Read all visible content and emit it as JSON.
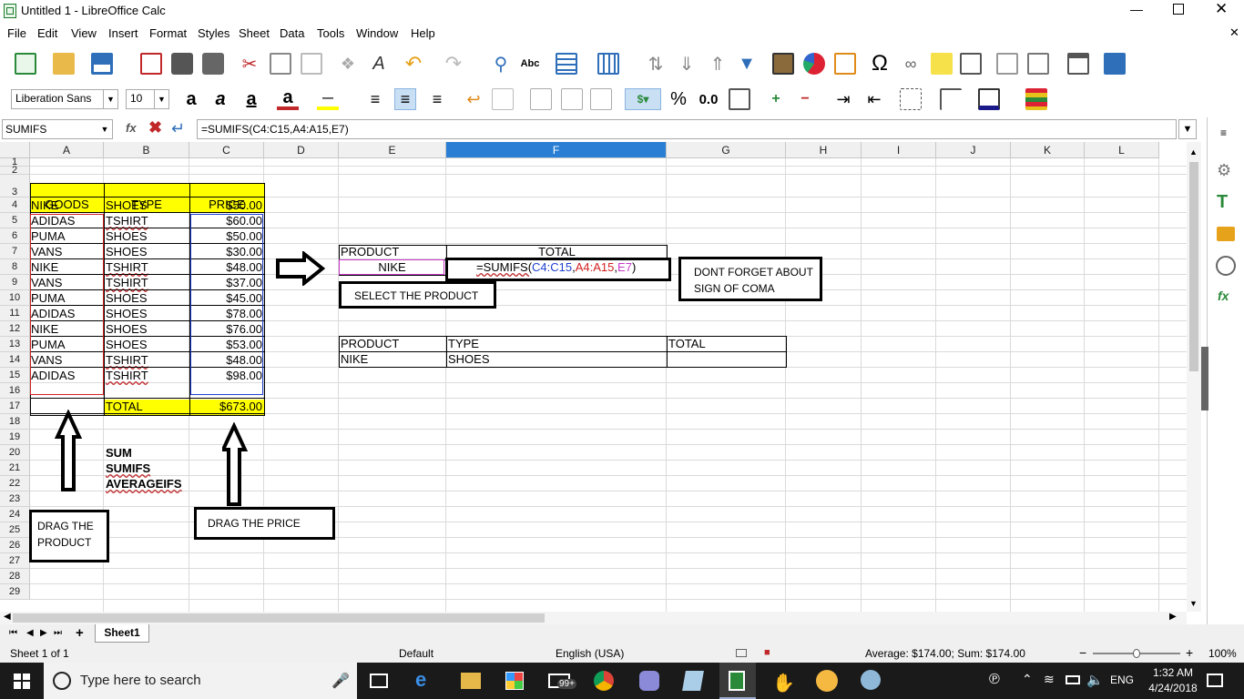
{
  "window": {
    "title": "Untitled 1 - LibreOffice Calc"
  },
  "menu": [
    "File",
    "Edit",
    "View",
    "Insert",
    "Format",
    "Styles",
    "Sheet",
    "Data",
    "Tools",
    "Window",
    "Help"
  ],
  "font": {
    "name": "Liberation Sans",
    "size": "10"
  },
  "namebox": "SUMIFS",
  "formula": "=SUMIFS(C4:C15,A4:A15,E7)",
  "columns": [
    "A",
    "B",
    "C",
    "D",
    "E",
    "F",
    "G",
    "H",
    "I",
    "J",
    "K",
    "L"
  ],
  "rows": [
    "1",
    "2",
    "3",
    "4",
    "5",
    "6",
    "7",
    "8",
    "9",
    "10",
    "11",
    "12",
    "13",
    "14",
    "15",
    "16",
    "17",
    "18",
    "19",
    "20",
    "21",
    "22",
    "23",
    "24",
    "25",
    "26",
    "27",
    "28",
    "29"
  ],
  "table": {
    "headers": [
      "GOODS",
      "TYPE",
      "PRICE"
    ],
    "rows": [
      [
        "NIKE",
        "SHOES",
        "$50.00"
      ],
      [
        "ADIDAS",
        "TSHIRT",
        "$60.00"
      ],
      [
        "PUMA",
        "SHOES",
        "$50.00"
      ],
      [
        "VANS",
        "SHOES",
        "$30.00"
      ],
      [
        "NIKE",
        "TSHIRT",
        "$48.00"
      ],
      [
        "VANS",
        "TSHIRT",
        "$37.00"
      ],
      [
        "PUMA",
        "SHOES",
        "$45.00"
      ],
      [
        "ADIDAS",
        "SHOES",
        "$78.00"
      ],
      [
        "NIKE",
        "SHOES",
        "$76.00"
      ],
      [
        "PUMA",
        "SHOES",
        "$53.00"
      ],
      [
        "VANS",
        "TSHIRT",
        "$48.00"
      ],
      [
        "ADIDAS",
        "TSHIRT",
        "$98.00"
      ]
    ],
    "total_label": "TOTAL",
    "total_value": "$673.00"
  },
  "lookup1": {
    "product_label": "PRODUCT",
    "total_label": "TOTAL",
    "product_value": "NIKE",
    "edit": {
      "prefix": "=SUMIFS(",
      "range1": "C4:C15",
      "sep1": ",",
      "range2": "A4:A15",
      "sep2": ",",
      "ref": "E7",
      "suffix": ")"
    }
  },
  "lookup2": {
    "product_label": "PRODUCT",
    "type_label": "TYPE",
    "total_label": "TOTAL",
    "product_value": "NIKE",
    "type_value": "SHOES"
  },
  "functions": [
    "SUM",
    "SUMIFS",
    "AVERAGEIFS"
  ],
  "notes": {
    "select_product": "SELECT THE PRODUCT",
    "dont_forget_1": "DONT FORGET ABOUT",
    "dont_forget_2": "SIGN OF COMA",
    "drag_product_1": "DRAG THE",
    "drag_product_2": "PRODUCT",
    "drag_price": "DRAG THE PRICE"
  },
  "sheet_tab": "Sheet1",
  "status": {
    "sheet": "Sheet 1 of 1",
    "style": "Default",
    "lang": "English (USA)",
    "summary": "Average: $174.00; Sum: $174.00",
    "zoom": "100%"
  },
  "taskbar": {
    "search_placeholder": "Type here to search",
    "badge": "99+",
    "lang": "ENG",
    "time": "1:32 AM",
    "date": "4/24/2018"
  },
  "colors": {
    "yellow": "#ffff00",
    "blue_ref": "#1f3fcf",
    "red_ref": "#d21f1f",
    "selected_col": "#2a7fd4"
  }
}
